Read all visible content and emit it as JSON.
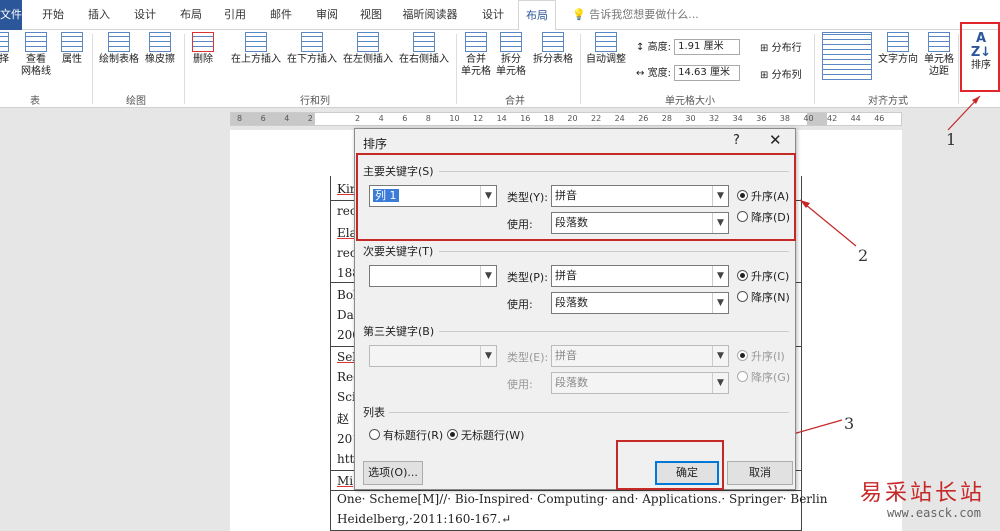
{
  "tabs": [
    "文件",
    "开始",
    "插入",
    "设计",
    "布局",
    "引用",
    "邮件",
    "审阅",
    "视图",
    "福昕阅读器",
    "设计",
    "布局"
  ],
  "tell_me": "告诉我您想要做什么...",
  "ribbon": {
    "table_group": {
      "buttons": [
        "择",
        "查看\n网格线",
        "属性"
      ],
      "label": "表"
    },
    "draw_group": {
      "buttons": [
        "绘制表格",
        "橡皮擦"
      ],
      "label": "绘图"
    },
    "rows_cols_group": {
      "buttons": [
        "删除",
        "在上方插入",
        "在下方插入",
        "在左侧插入",
        "在右侧插入"
      ],
      "label": "行和列"
    },
    "merge_group": {
      "buttons": [
        "合并\n单元格",
        "拆分\n单元格",
        "拆分表格"
      ],
      "label": "合并"
    },
    "cell_size_group": {
      "autofit": "自动调整",
      "height_label": "高度:",
      "height_value": "1.91 厘米",
      "width_label": "宽度:",
      "width_value": "14.63 厘米",
      "distribute_rows": "分布行",
      "distribute_cols": "分布列",
      "label": "单元格大小"
    },
    "align_group": {
      "text_direction": "文字方向",
      "cell_margins": "单元格\n边距",
      "label": "对齐方式"
    },
    "data_group": {
      "sort": "排序"
    }
  },
  "ruler": [
    "8",
    "6",
    "4",
    "2",
    "",
    "2",
    "4",
    "6",
    "8",
    "10",
    "12",
    "14",
    "16",
    "18",
    "20",
    "22",
    "24",
    "26",
    "28",
    "30",
    "32",
    "34",
    "36",
    "38",
    "40",
    "42",
    "44",
    "46"
  ],
  "document": {
    "lines": [
      "Kir",
      "rec",
      "Ela",
      "rec",
      "188",
      "Bol",
      "Dat",
      "200",
      "Sel",
      "Rec",
      "Sci",
      "赵",
      "201",
      "http",
      "Mi"
    ],
    "tail_line1": "One· Scheme[M]//· Bio-Inspired· Computing· and· Applications.· Springer· Berlin",
    "tail_line2": "Heidelberg,·2011:160-167.↵"
  },
  "dialog": {
    "title": "排序",
    "help": "?",
    "close": "✕",
    "primary": {
      "heading": "主要关键字(S)",
      "key": "列 1",
      "type_label": "类型(Y):",
      "type": "拼音",
      "use_label": "使用:",
      "use": "段落数",
      "asc": "升序(A)",
      "desc": "降序(D)"
    },
    "secondary": {
      "heading": "次要关键字(T)",
      "key": "",
      "type_label": "类型(P):",
      "type": "拼音",
      "use_label": "使用:",
      "use": "段落数",
      "asc": "升序(C)",
      "desc": "降序(N)"
    },
    "tertiary": {
      "heading": "第三关键字(B)",
      "key": "",
      "type_label": "类型(E):",
      "type": "拼音",
      "use_label": "使用:",
      "use": "段落数",
      "asc": "升序(I)",
      "desc": "降序(G)"
    },
    "list": {
      "heading": "列表",
      "header_row": "有标题行(R)",
      "no_header_row": "无标题行(W)"
    },
    "options_button": "选项(O)...",
    "ok_button": "确定",
    "cancel_button": "取消"
  },
  "annotations": [
    "1",
    "2",
    "3"
  ],
  "watermark": {
    "text": "易采站长站",
    "url": "www.easck.com"
  },
  "colors": {
    "accent": "#2b579a",
    "highlight_red": "#c62828",
    "selection": "#3b7cd8"
  }
}
